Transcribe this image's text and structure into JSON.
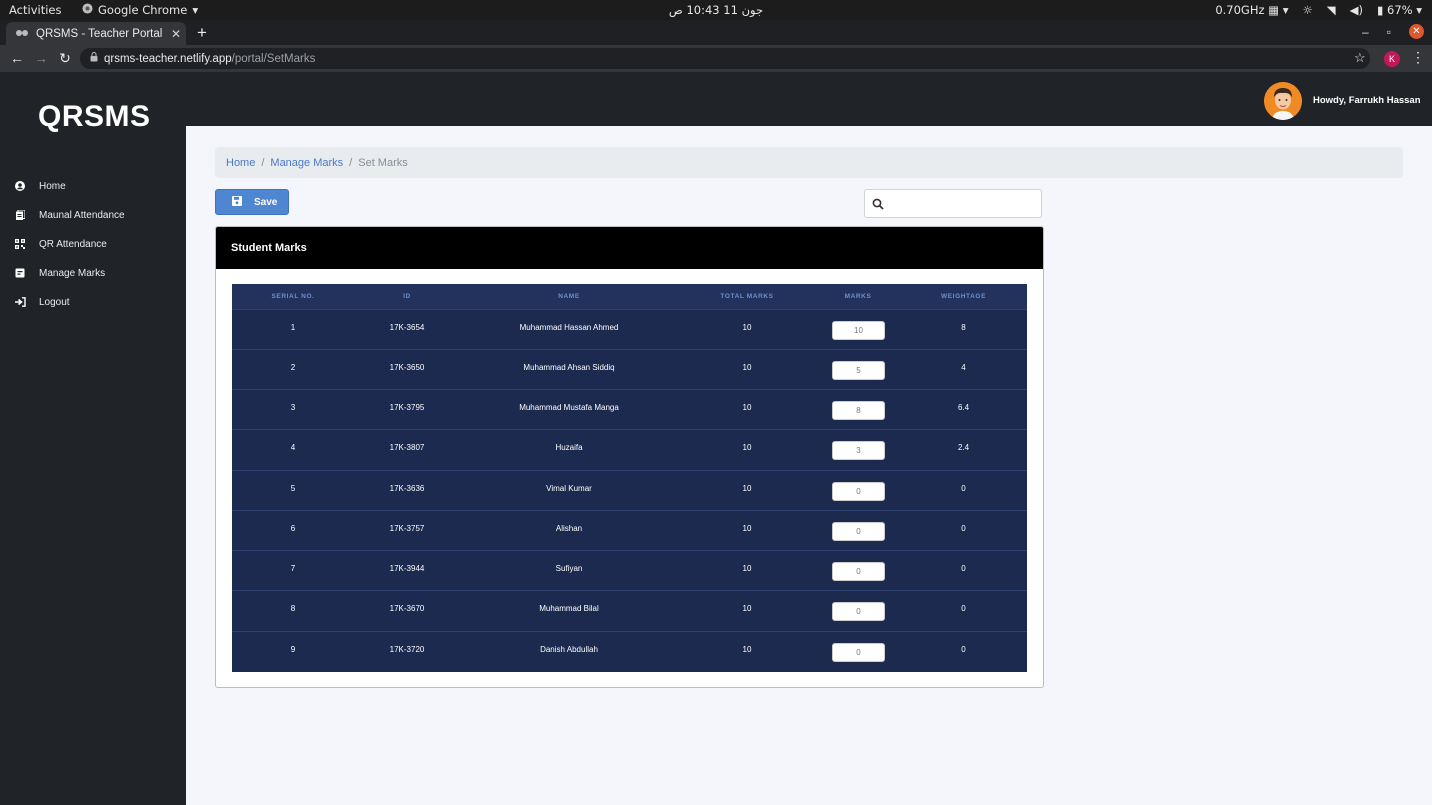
{
  "os": {
    "activities": "Activities",
    "app_name": "Google Chrome",
    "clock": "جون 11  10:43 ص",
    "cpu": "0.70GHz",
    "battery": "67%"
  },
  "browser": {
    "tab_title": "QRSMS - Teacher Portal",
    "url_host": "qrsms-teacher.netlify.app",
    "url_path": "/portal/SetMarks",
    "profile_initial": "K"
  },
  "sidebar": {
    "brand": "QRSMS",
    "items": [
      {
        "label": "Home",
        "icon": "user-circle-icon"
      },
      {
        "label": "Maunal Attendance",
        "icon": "clipboard-icon"
      },
      {
        "label": "QR Attendance",
        "icon": "qr-code-icon"
      },
      {
        "label": "Manage Marks",
        "icon": "marks-icon"
      },
      {
        "label": "Logout",
        "icon": "logout-icon"
      }
    ]
  },
  "header": {
    "greeting": "Howdy, Farrukh Hassan"
  },
  "breadcrumb": {
    "home": "Home",
    "manage": "Manage Marks",
    "current": "Set Marks"
  },
  "toolbar": {
    "save_label": "Save",
    "search_placeholder": ""
  },
  "card": {
    "title": "Student Marks",
    "columns": [
      "SERIAL NO.",
      "ID",
      "NAME",
      "TOTAL MARKS",
      "MARKS",
      "WEIGHTAGE"
    ],
    "rows": [
      {
        "serial": "1",
        "id": "17K-3654",
        "name": "Muhammad Hassan Ahmed",
        "total": "10",
        "marks": "10",
        "weightage": "8"
      },
      {
        "serial": "2",
        "id": "17K-3650",
        "name": "Muhammad Ahsan Siddiq",
        "total": "10",
        "marks": "5",
        "weightage": "4"
      },
      {
        "serial": "3",
        "id": "17K-3795",
        "name": "Muhammad Mustafa Manga",
        "total": "10",
        "marks": "8",
        "weightage": "6.4"
      },
      {
        "serial": "4",
        "id": "17K-3807",
        "name": "Huzaifa",
        "total": "10",
        "marks": "3",
        "weightage": "2.4"
      },
      {
        "serial": "5",
        "id": "17K-3636",
        "name": "Vimal Kumar",
        "total": "10",
        "marks": "0",
        "weightage": "0"
      },
      {
        "serial": "6",
        "id": "17K-3757",
        "name": "Alishan",
        "total": "10",
        "marks": "0",
        "weightage": "0"
      },
      {
        "serial": "7",
        "id": "17K-3944",
        "name": "Sufiyan",
        "total": "10",
        "marks": "0",
        "weightage": "0"
      },
      {
        "serial": "8",
        "id": "17K-3670",
        "name": "Muhammad Bilal",
        "total": "10",
        "marks": "0",
        "weightage": "0"
      },
      {
        "serial": "9",
        "id": "17K-3720",
        "name": "Danish Abdullah",
        "total": "10",
        "marks": "0",
        "weightage": "0"
      }
    ]
  },
  "colors": {
    "sidebar_bg": "#202328",
    "table_bg": "#1b2a4e",
    "header_text": "#6e8fcf",
    "accent": "#4f86d1"
  }
}
